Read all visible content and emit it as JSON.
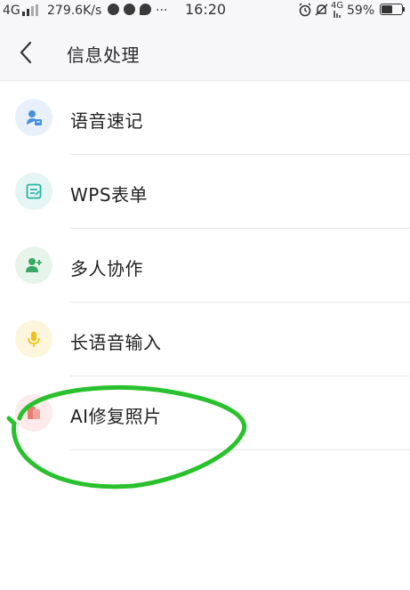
{
  "status_bar": {
    "network": "4G",
    "speed": "279.6K/s",
    "extra": "···",
    "time": "16:20",
    "network_right": "4G",
    "battery_percent": "59%",
    "battery_level": 0.59
  },
  "nav": {
    "title": "信息处理",
    "back_icon": "chevron-left-icon"
  },
  "items": [
    {
      "label": "语音速记",
      "icon": "voice-memo-icon",
      "icon_bg": "#e8f1fb",
      "icon_color": "#4a90d9"
    },
    {
      "label": "WPS表单",
      "icon": "form-icon",
      "icon_bg": "#e5f5f3",
      "icon_color": "#2bb3a3"
    },
    {
      "label": "多人协作",
      "icon": "add-user-icon",
      "icon_bg": "#e6f4ea",
      "icon_color": "#3aa865"
    },
    {
      "label": "长语音输入",
      "icon": "microphone-icon",
      "icon_bg": "#fdf6dc",
      "icon_color": "#f2c21b"
    },
    {
      "label": "AI修复照片",
      "icon": "photo-repair-icon",
      "icon_bg": "#fcebea",
      "icon_color": "#e46b5f"
    }
  ],
  "colors": {
    "header_bg": "#f7f7f9",
    "annotation_stroke": "#29c22e"
  }
}
